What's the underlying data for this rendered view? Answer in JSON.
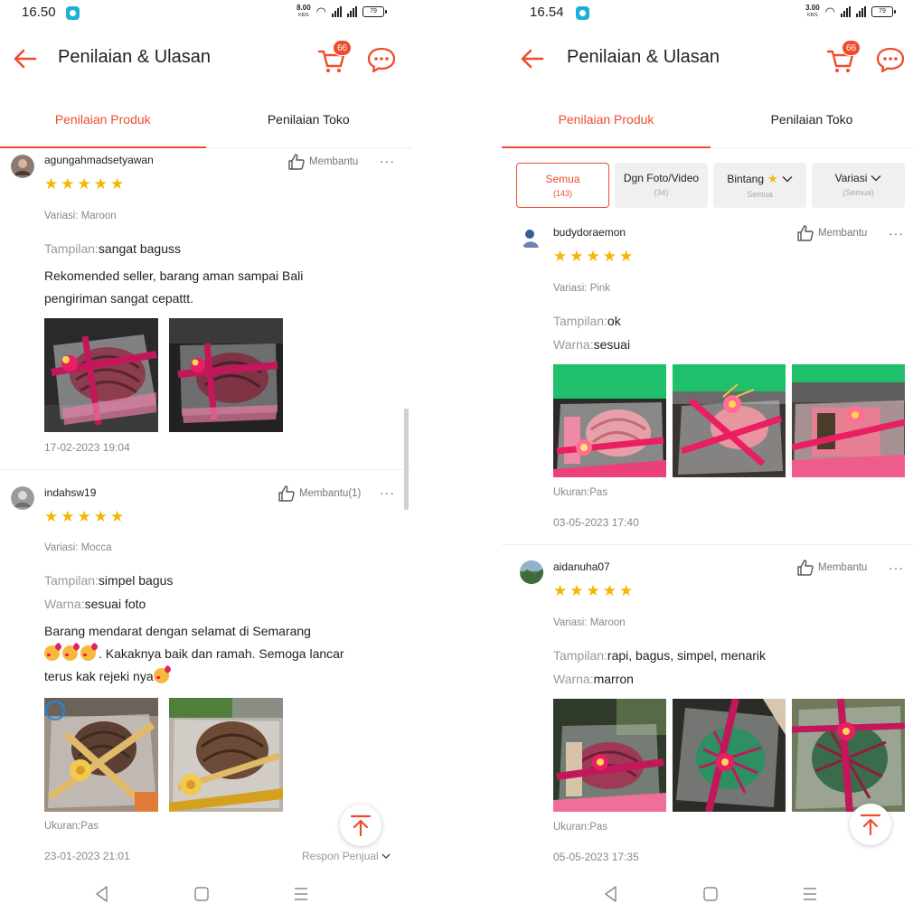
{
  "colors": {
    "accent": "#ee4d2d",
    "star": "#f7b500",
    "muted": "#888888"
  },
  "left": {
    "status": {
      "time": "16.50",
      "net_speed": "8.00",
      "net_unit": "KB/S",
      "battery": "79"
    },
    "header": {
      "title": "Penilaian & Ulasan",
      "cart_count": "66"
    },
    "tabs": [
      "Penilaian Produk",
      "Penilaian Toko"
    ],
    "reviews": [
      {
        "username": "agungahmadsetyawan",
        "helpful": "Membantu",
        "rating": 5,
        "variant": "Variasi: Maroon",
        "fields": [
          {
            "key": "Tampilan:",
            "value": "sangat baguss"
          }
        ],
        "text_lines": [
          "Rekomended seller,  barang aman sampai Bali",
          "pengiriman sangat cepattt."
        ],
        "date": "17-02-2023 19:04"
      },
      {
        "username": "indahsw19",
        "helpful": "Membantu(1)",
        "rating": 5,
        "variant": "Variasi: Mocca",
        "fields": [
          {
            "key": "Tampilan:",
            "value": "simpel bagus"
          },
          {
            "key": "Warna:",
            "value": "sesuai foto"
          }
        ],
        "text_lines": [
          "Barang mendarat dengan selamat di Semarang",
          ". Kakaknya baik dan ramah.  Semoga lancar",
          "terus kak rejeki nya"
        ],
        "size": "Ukuran:Pas",
        "date": "23-01-2023 21:01",
        "seller_reply": "Respon Penjual"
      }
    ]
  },
  "right": {
    "status": {
      "time": "16.54",
      "net_speed": "3.00",
      "net_unit": "KB/S",
      "battery": "79"
    },
    "header": {
      "title": "Penilaian & Ulasan",
      "cart_count": "66"
    },
    "tabs": [
      "Penilaian Produk",
      "Penilaian Toko"
    ],
    "filters": [
      {
        "label": "Semua",
        "sub": "(143)"
      },
      {
        "label": "Dgn Foto/Video",
        "sub": "(34)"
      },
      {
        "label": "Bintang",
        "sub": "Semua"
      },
      {
        "label": "Variasi",
        "sub": "(Semua)"
      }
    ],
    "reviews": [
      {
        "username": "budydoraemon",
        "helpful": "Membantu",
        "rating": 5,
        "variant": "Variasi: Pink",
        "fields": [
          {
            "key": "Tampilan:",
            "value": "ok"
          },
          {
            "key": "Warna:",
            "value": "sesuai"
          }
        ],
        "size": "Ukuran:Pas",
        "date": "03-05-2023 17:40"
      },
      {
        "username": "aidanuha07",
        "helpful": "Membantu",
        "rating": 5,
        "variant": "Variasi: Maroon",
        "fields": [
          {
            "key": "Tampilan:",
            "value": "rapi, bagus, simpel, menarik"
          },
          {
            "key": "Warna:",
            "value": "marron"
          }
        ],
        "size": "Ukuran:Pas",
        "date": "05-05-2023 17:35"
      }
    ]
  },
  "icons": {
    "back": "arrow-left-icon",
    "cart": "shopping-cart-icon",
    "chat": "chat-bubble-icon",
    "helpful": "thumbs-up-icon",
    "more": "more-dots-icon",
    "scroll_top": "arrow-up-icon",
    "nav_back": "triangle-back-icon",
    "nav_home": "square-home-icon",
    "nav_menu": "hamburger-menu-icon"
  }
}
